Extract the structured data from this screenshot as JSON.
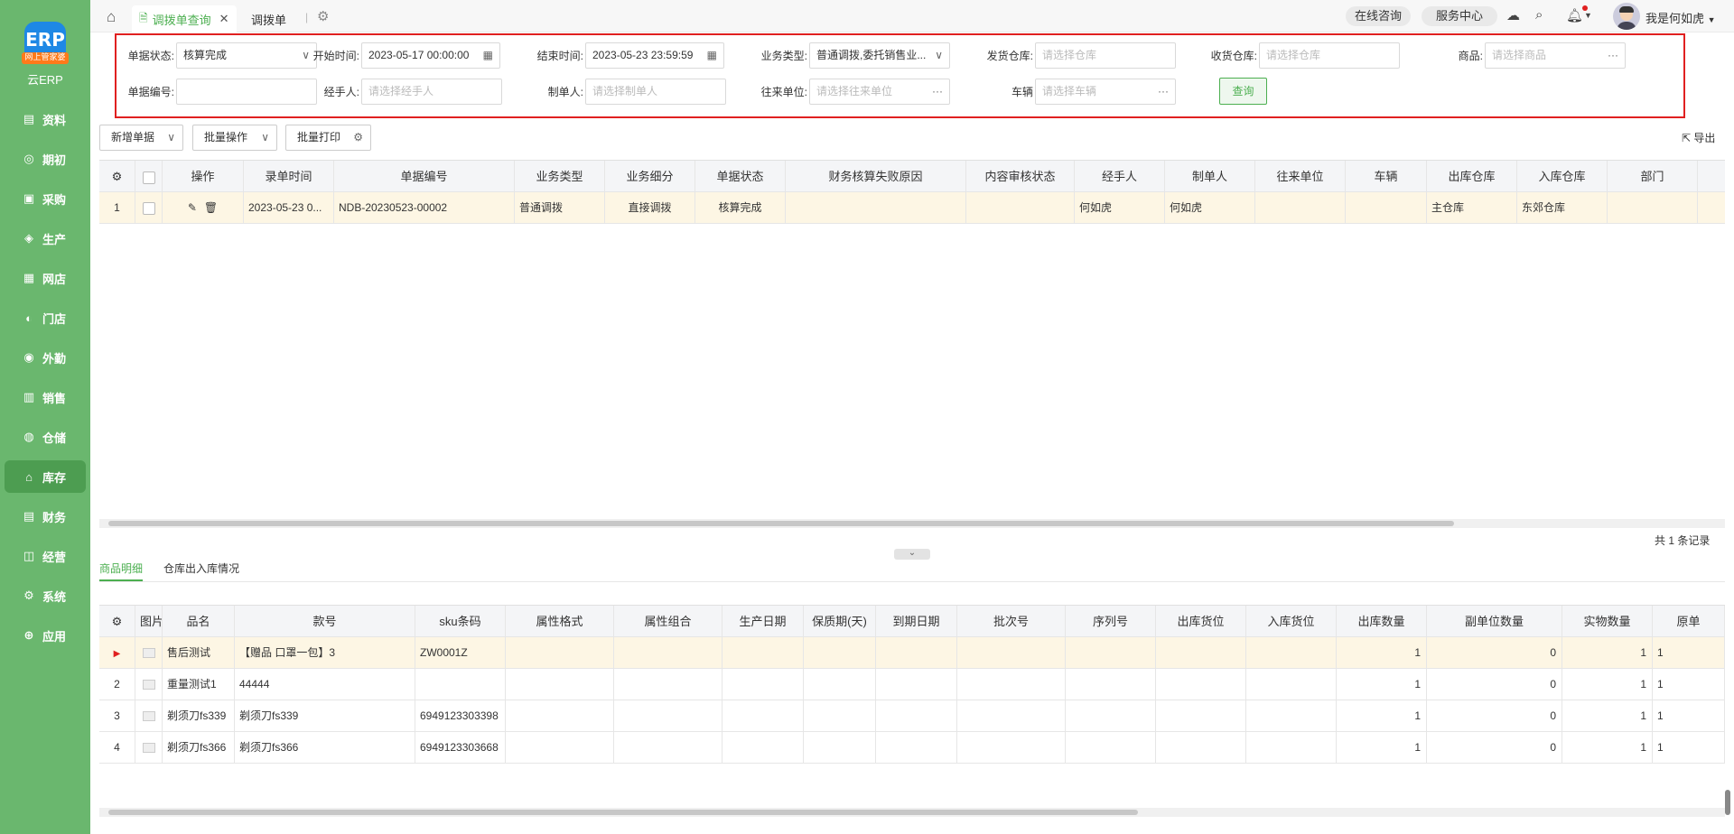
{
  "app": {
    "logo_text": "ERP",
    "logo_badge": "网上管家婆",
    "name": "云ERP"
  },
  "nav": [
    {
      "label": "资料",
      "icon": "doc-icon"
    },
    {
      "label": "期初",
      "icon": "circle-icon"
    },
    {
      "label": "采购",
      "icon": "cart-icon"
    },
    {
      "label": "生产",
      "icon": "factory-icon"
    },
    {
      "label": "网店",
      "icon": "shop-icon"
    },
    {
      "label": "门店",
      "icon": "store-icon"
    },
    {
      "label": "外勤",
      "icon": "location-icon"
    },
    {
      "label": "销售",
      "icon": "chart-icon"
    },
    {
      "label": "仓储",
      "icon": "warehouse-icon"
    },
    {
      "label": "库存",
      "icon": "home-icon",
      "active": true
    },
    {
      "label": "财务",
      "icon": "finance-icon"
    },
    {
      "label": "经营",
      "icon": "manage-icon"
    },
    {
      "label": "系统",
      "icon": "settings-icon"
    },
    {
      "label": "应用",
      "icon": "plus-icon"
    }
  ],
  "tabs": {
    "active": "调拨单查询",
    "second": "调拨单"
  },
  "header": {
    "consult": "在线咨询",
    "service": "服务中心",
    "user": "我是何如虎"
  },
  "filters": {
    "status_label": "单据状态:",
    "status_value": "核算完成",
    "start_label": "开始时间:",
    "start_value": "2023-05-17 00:00:00",
    "end_label": "结束时间:",
    "end_value": "2023-05-23 23:59:59",
    "biz_label": "业务类型:",
    "biz_value": "普通调拨,委托销售业...",
    "ship_wh_label": "发货仓库:",
    "ship_wh_ph": "请选择仓库",
    "recv_wh_label": "收货仓库:",
    "recv_wh_ph": "请选择仓库",
    "goods_label": "商品:",
    "goods_ph": "请选择商品",
    "no_label": "单据编号:",
    "no_value": "",
    "handler_label": "经手人:",
    "handler_ph": "请选择经手人",
    "maker_label": "制单人:",
    "maker_ph": "请选择制单人",
    "partner_label": "往来单位:",
    "partner_ph": "请选择往来单位",
    "vehicle_label": "车辆",
    "vehicle_ph": "请选择车辆",
    "query": "查询"
  },
  "toolbar": {
    "new": "新增单据",
    "batch": "批量操作",
    "print": "批量打印",
    "export": "导出"
  },
  "orders": {
    "columns": [
      "操作",
      "录单时间",
      "单据编号",
      "业务类型",
      "业务细分",
      "单据状态",
      "财务核算失败原因",
      "内容审核状态",
      "经手人",
      "制单人",
      "往来单位",
      "车辆",
      "出库仓库",
      "入库仓库",
      "部门"
    ],
    "rows": [
      {
        "index": "1",
        "time": "2023-05-23 0...",
        "no": "NDB-20230523-00002",
        "type": "普通调拨",
        "sub": "直接调拨",
        "status": "核算完成",
        "fail": "",
        "audit": "",
        "handler": "何如虎",
        "maker": "何如虎",
        "partner": "",
        "vehicle": "",
        "out_wh": "主仓库",
        "in_wh": "东郊仓库",
        "dept": ""
      }
    ],
    "total": "共 1 条记录"
  },
  "bottom_tabs": {
    "detail": "商品明细",
    "wh_status": "仓库出入库情况"
  },
  "details": {
    "columns": [
      "图片",
      "品名",
      "款号",
      "sku条码",
      "属性格式",
      "属性组合",
      "生产日期",
      "保质期(天)",
      "到期日期",
      "批次号",
      "序列号",
      "出库货位",
      "入库货位",
      "出库数量",
      "副单位数量",
      "实物数量",
      "原单"
    ],
    "rows": [
      {
        "index": "",
        "name": "售后测试",
        "style": "【赠品 口罩一包】3",
        "sku": "ZW0001Z",
        "out_qty": "1",
        "sub_qty": "0",
        "real_qty": "1",
        "orig": "1"
      },
      {
        "index": "2",
        "name": "重量测试1",
        "style": "44444",
        "sku": "",
        "out_qty": "1",
        "sub_qty": "0",
        "real_qty": "1",
        "orig": "1"
      },
      {
        "index": "3",
        "name": "剃须刀fs339",
        "style": "剃须刀fs339",
        "sku": "6949123303398",
        "out_qty": "1",
        "sub_qty": "0",
        "real_qty": "1",
        "orig": "1"
      },
      {
        "index": "4",
        "name": "剃须刀fs366",
        "style": "剃须刀fs366",
        "sku": "6949123303668",
        "out_qty": "1",
        "sub_qty": "0",
        "real_qty": "1",
        "orig": "1"
      }
    ]
  },
  "colors": {
    "sidebar": "#6ab76e",
    "accent": "#4caf50",
    "highlight": "#e02020"
  }
}
